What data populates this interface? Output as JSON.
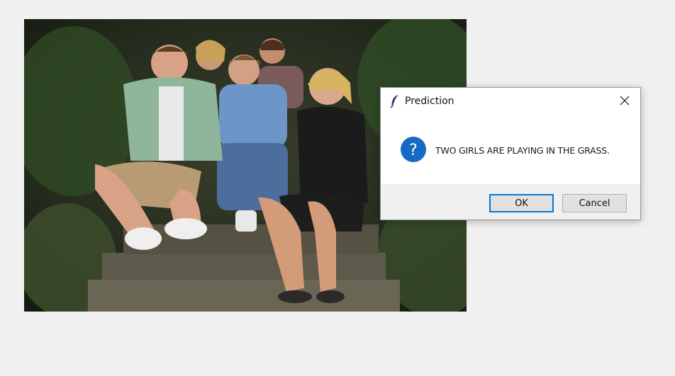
{
  "photo": {
    "icon": "photo-family-on-steps"
  },
  "dialog": {
    "title": "Prediction",
    "title_icon": "feather-icon",
    "close_icon": "close-icon",
    "message_icon": "question-icon",
    "message": "TWO GIRLS ARE PLAYING IN THE GRASS.",
    "buttons": {
      "ok": "OK",
      "cancel": "Cancel"
    },
    "colors": {
      "accent": "#0078d7",
      "question_icon": "#1565c0"
    }
  }
}
